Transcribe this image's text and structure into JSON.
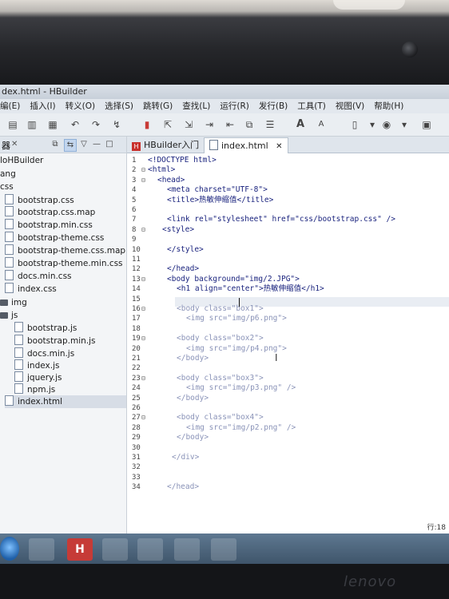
{
  "window": {
    "title": "index.html - HBuilder",
    "title_visible": "dex.html - HBuilder"
  },
  "menu": [
    "编(E)",
    "插入(I)",
    "转义(O)",
    "选择(S)",
    "跳转(G)",
    "查找(L)",
    "运行(R)",
    "发行(B)",
    "工具(T)",
    "视图(V)",
    "帮助(H)"
  ],
  "toolbar_icons": [
    "save-icon",
    "save-all-icon",
    "format-icon",
    "undo-icon",
    "redo-icon",
    "jump-icon",
    "bookmark-icon",
    "open-icon",
    "export-icon",
    "step-icon",
    "step-out-icon",
    "copy-icon",
    "list-icon",
    "font-increase-icon",
    "font-decrease-icon",
    "new-file-icon",
    "dropdown-icon",
    "browser-icon",
    "dropdown-icon",
    "comment-icon"
  ],
  "toolbar_labels": {
    "font_up": "A",
    "font_down": "A"
  },
  "sidebar": {
    "header": "器",
    "tree": [
      {
        "label": "loHBuilder",
        "kind": "text",
        "indent": 0
      },
      {
        "label": "ang",
        "kind": "text",
        "indent": 0
      },
      {
        "label": "css",
        "kind": "text",
        "indent": 0
      },
      {
        "label": "bootstrap.css",
        "kind": "file",
        "indent": 1
      },
      {
        "label": "bootstrap.css.map",
        "kind": "file",
        "indent": 1
      },
      {
        "label": "bootstrap.min.css",
        "kind": "file",
        "indent": 1
      },
      {
        "label": "bootstrap-theme.css",
        "kind": "file",
        "indent": 1
      },
      {
        "label": "bootstrap-theme.css.map",
        "kind": "file",
        "indent": 1
      },
      {
        "label": "bootstrap-theme.min.css",
        "kind": "file",
        "indent": 1
      },
      {
        "label": "docs.min.css",
        "kind": "file",
        "indent": 1
      },
      {
        "label": "index.css",
        "kind": "file",
        "indent": 1
      },
      {
        "label": "img",
        "kind": "folder",
        "indent": 0
      },
      {
        "label": "js",
        "kind": "folder",
        "indent": 0
      },
      {
        "label": "bootstrap.js",
        "kind": "file",
        "indent": 2
      },
      {
        "label": "bootstrap.min.js",
        "kind": "file",
        "indent": 2
      },
      {
        "label": "docs.min.js",
        "kind": "file",
        "indent": 2
      },
      {
        "label": "index.js",
        "kind": "file",
        "indent": 2
      },
      {
        "label": "jquery.js",
        "kind": "file",
        "indent": 2
      },
      {
        "label": "npm.js",
        "kind": "file",
        "indent": 2
      },
      {
        "label": "index.html",
        "kind": "file",
        "indent": 1,
        "selected": true
      }
    ]
  },
  "tabs": [
    {
      "label": "HBuilder入门",
      "active": false
    },
    {
      "label": "index.html",
      "active": true,
      "close": "✕"
    }
  ],
  "code": [
    {
      "n": "1",
      "indent": 0,
      "text": "<!DOCTYPE html>"
    },
    {
      "n": "2",
      "indent": 0,
      "fold": "⊟",
      "text": "<html>"
    },
    {
      "n": "3",
      "indent": 2,
      "fold": "⊟",
      "text": "<head>"
    },
    {
      "n": "4",
      "indent": 4,
      "text": "<meta charset=\"UTF-8\">"
    },
    {
      "n": "5",
      "indent": 4,
      "text": "<title>热敏伸缩值</title>"
    },
    {
      "n": "6",
      "indent": 0,
      "text": ""
    },
    {
      "n": "7",
      "indent": 4,
      "text": "<link rel=\"stylesheet\" href=\"css/bootstrap.css\" />"
    },
    {
      "n": "8",
      "indent": 3,
      "fold": "⊟",
      "text": "<style>"
    },
    {
      "n": "9",
      "indent": 0,
      "text": ""
    },
    {
      "n": "10",
      "indent": 4,
      "text": "</style>"
    },
    {
      "n": "11",
      "indent": 0,
      "text": ""
    },
    {
      "n": "12",
      "indent": 4,
      "text": "</head>"
    },
    {
      "n": "13",
      "indent": 4,
      "fold": "⊟",
      "text": "<body background=\"img/2.JPG\">"
    },
    {
      "n": "14",
      "indent": 6,
      "text": "<h1 align=\"center\">热敏伸缩值</h1>"
    },
    {
      "n": "15",
      "indent": 0,
      "text": ""
    },
    {
      "n": "16",
      "indent": 6,
      "fold": "⊟",
      "text": "<body class=\"box1\">"
    },
    {
      "n": "17",
      "indent": 8,
      "text": "<img src=\"img/p6.png\">"
    },
    {
      "n": "18",
      "indent": 0,
      "text": ""
    },
    {
      "n": "19",
      "indent": 6,
      "fold": "⊟",
      "text": "<body class=\"box2\">"
    },
    {
      "n": "20",
      "indent": 8,
      "text": "<img src=\"img/p4.png\">"
    },
    {
      "n": "21",
      "indent": 6,
      "text": "</body>"
    },
    {
      "n": "22",
      "indent": 0,
      "text": ""
    },
    {
      "n": "23",
      "indent": 6,
      "fold": "⊟",
      "text": "<body class=\"box3\">"
    },
    {
      "n": "24",
      "indent": 8,
      "text": "<img src=\"img/p3.png\" />"
    },
    {
      "n": "25",
      "indent": 6,
      "text": "</body>"
    },
    {
      "n": "26",
      "indent": 0,
      "text": ""
    },
    {
      "n": "27",
      "indent": 6,
      "fold": "⊟",
      "text": "<body class=\"box4\">"
    },
    {
      "n": "28",
      "indent": 8,
      "text": "<img src=\"img/p2.png\" />"
    },
    {
      "n": "29",
      "indent": 6,
      "text": "</body>"
    },
    {
      "n": "30",
      "indent": 0,
      "text": ""
    },
    {
      "n": "31",
      "indent": 5,
      "text": "</div>"
    },
    {
      "n": "32",
      "indent": 0,
      "text": ""
    },
    {
      "n": "33",
      "indent": 0,
      "text": ""
    },
    {
      "n": "34",
      "indent": 4,
      "text": "</head>"
    }
  ],
  "status": {
    "right": "行:18"
  },
  "laptop": {
    "brand": "lenovo"
  }
}
